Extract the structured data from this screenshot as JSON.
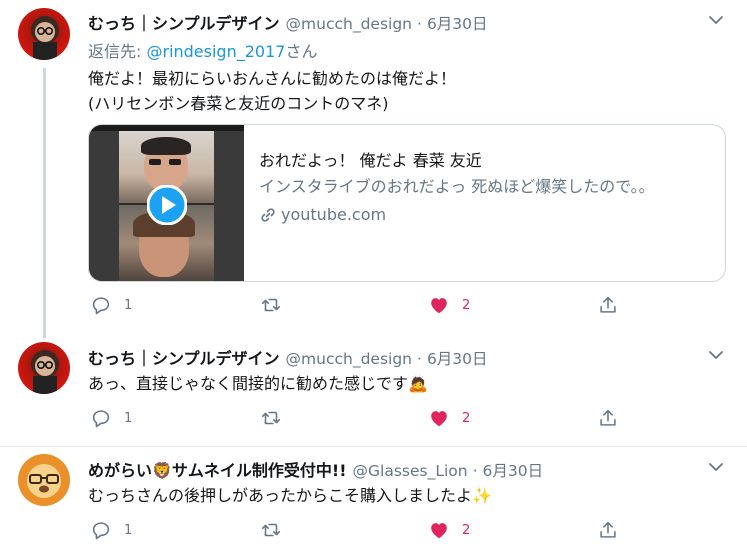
{
  "colors": {
    "accent_blue": "#1b95e0",
    "like_red": "#e0245e",
    "gray_text": "#657786",
    "divider": "#e6ecf0"
  },
  "tweets": [
    {
      "name": "むっち｜シンプルデザイン",
      "handle": "@mucch_design",
      "dot": "·",
      "date": "6月30日",
      "reply_prefix": "返信先: ",
      "reply_mention": "@rindesign_2017",
      "reply_suffix": "さん",
      "lines": [
        "俺だよ！最初にらいおんさんに勧めたのは俺だよ！",
        "(ハリセンボン春菜と友近のコントのマネ)"
      ],
      "card": {
        "title": "おれだよっ！ 俺だよ 春菜 友近",
        "description": "インスタライブのおれだよっ 死ぬほど爆笑したので。。",
        "link_icon": "link-icon",
        "domain": "youtube.com"
      },
      "reply_count": "1",
      "retweet_count": "",
      "like_count": "2"
    },
    {
      "name": "むっち｜シンプルデザイン",
      "handle": "@mucch_design",
      "dot": "·",
      "date": "6月30日",
      "lines": [
        "あっ、直接じゃなく間接的に勧めた感じです🙇"
      ],
      "reply_count": "1",
      "retweet_count": "",
      "like_count": "2"
    },
    {
      "name": "めがらい🦁サムネイル制作受付中!!",
      "handle": "@Glasses_Lion",
      "dot": "·",
      "date": "6月30日",
      "lines": [
        "むっちさんの後押しがあったからこそ購入しましたよ✨"
      ],
      "reply_count": "1",
      "retweet_count": "",
      "like_count": "2"
    }
  ]
}
